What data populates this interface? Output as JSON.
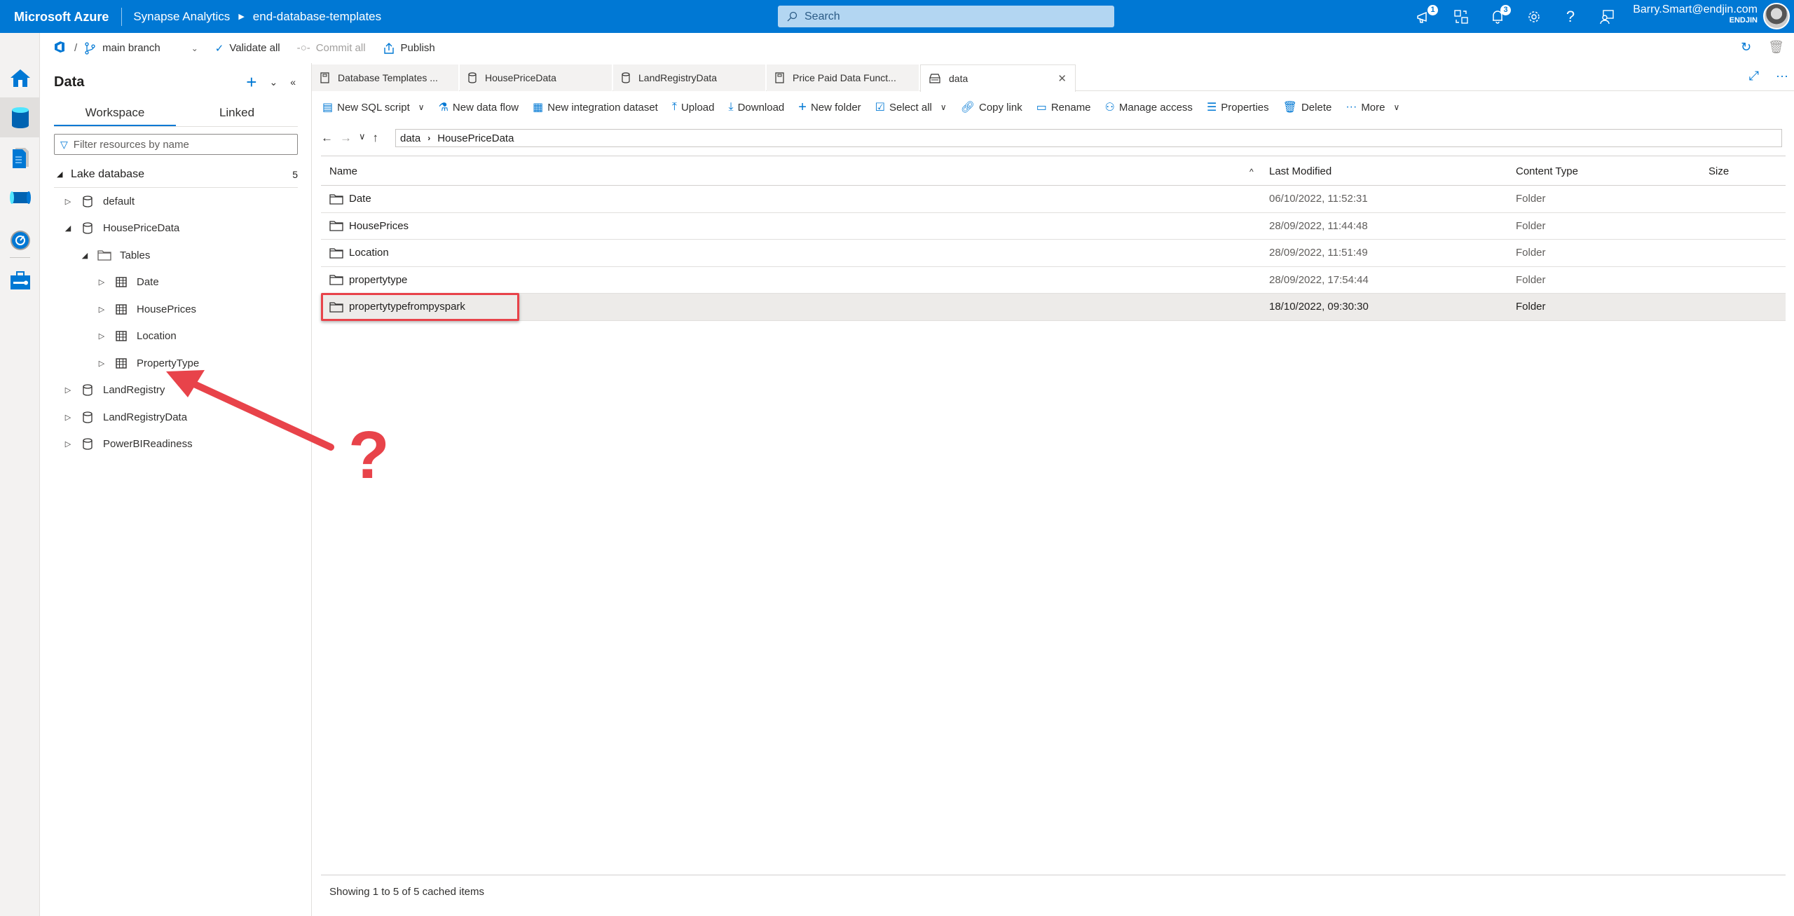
{
  "topbar": {
    "brand": "Microsoft Azure",
    "service": "Synapse Analytics",
    "workspace": "end-database-templates",
    "search_placeholder": "Search",
    "announcements_badge": "1",
    "notifications_badge": "3",
    "user_email": "Barry.Smart@endjin.com",
    "user_org": "ENDJIN"
  },
  "subbar": {
    "separator": "/",
    "branch": "main branch",
    "validate_all": "Validate all",
    "commit_all": "Commit all",
    "publish": "Publish"
  },
  "rail": {
    "items": [
      {
        "name": "home",
        "icon": "home-icon"
      },
      {
        "name": "data",
        "icon": "database-icon",
        "active": true
      },
      {
        "name": "develop",
        "icon": "document-icon"
      },
      {
        "name": "integrate",
        "icon": "pipeline-icon"
      },
      {
        "name": "monitor",
        "icon": "gauge-icon"
      },
      {
        "name": "manage",
        "icon": "toolbox-icon"
      }
    ]
  },
  "datapanel": {
    "title": "Data",
    "tabs": [
      {
        "label": "Workspace",
        "active": true
      },
      {
        "label": "Linked",
        "active": false
      }
    ],
    "filter_placeholder": "Filter resources by name",
    "section": {
      "label": "Lake database",
      "count": "5"
    },
    "tree": [
      {
        "label": "default",
        "level": 1,
        "expanded": false,
        "icon": "database-icon"
      },
      {
        "label": "HousePriceData",
        "level": 1,
        "expanded": true,
        "icon": "database-icon"
      },
      {
        "label": "Tables",
        "level": 2,
        "expanded": true,
        "icon": "folder-icon"
      },
      {
        "label": "Date",
        "level": 3,
        "expanded": false,
        "icon": "table-icon"
      },
      {
        "label": "HousePrices",
        "level": 3,
        "expanded": false,
        "icon": "table-icon"
      },
      {
        "label": "Location",
        "level": 3,
        "expanded": false,
        "icon": "table-icon"
      },
      {
        "label": "PropertyType",
        "level": 3,
        "expanded": false,
        "icon": "table-icon"
      },
      {
        "label": "LandRegistry",
        "level": 1,
        "expanded": false,
        "icon": "database-icon"
      },
      {
        "label": "LandRegistryData",
        "level": 1,
        "expanded": false,
        "icon": "database-icon"
      },
      {
        "label": "PowerBIReadiness",
        "level": 1,
        "expanded": false,
        "icon": "database-icon"
      }
    ]
  },
  "doc_tabs": [
    {
      "label": "Database Templates ...",
      "icon": "notebook-icon"
    },
    {
      "label": "HousePriceData",
      "icon": "database-icon"
    },
    {
      "label": "LandRegistryData",
      "icon": "database-icon"
    },
    {
      "label": "Price Paid Data Funct...",
      "icon": "notebook-icon"
    },
    {
      "label": "data",
      "icon": "storage-icon",
      "active": true,
      "closable": true
    }
  ],
  "toolbar": {
    "new_sql_script": "New SQL script",
    "new_data_flow": "New data flow",
    "new_integration_dataset": "New integration dataset",
    "upload": "Upload",
    "download": "Download",
    "new_folder": "New folder",
    "select_all": "Select all",
    "copy_link": "Copy link",
    "rename": "Rename",
    "manage_access": "Manage access",
    "properties": "Properties",
    "delete": "Delete",
    "more": "More"
  },
  "path": {
    "segments": [
      "data",
      "HousePriceData"
    ]
  },
  "table": {
    "columns": [
      "Name",
      "Last Modified",
      "Content Type",
      "Size"
    ],
    "sort_indicator": "^",
    "rows": [
      {
        "name": "Date",
        "modified": "06/10/2022, 11:52:31",
        "type": "Folder",
        "size": ""
      },
      {
        "name": "HousePrices",
        "modified": "28/09/2022, 11:44:48",
        "type": "Folder",
        "size": ""
      },
      {
        "name": "Location",
        "modified": "28/09/2022, 11:51:49",
        "type": "Folder",
        "size": ""
      },
      {
        "name": "propertytype",
        "modified": "28/09/2022, 17:54:44",
        "type": "Folder",
        "size": ""
      },
      {
        "name": "propertytypefrompyspark",
        "modified": "18/10/2022, 09:30:30",
        "type": "Folder",
        "size": "",
        "selected": true
      }
    ]
  },
  "footer": {
    "status": "Showing 1 to 5 of 5 cached items"
  },
  "annotation": {
    "symbol": "?",
    "color": "#e8434a"
  },
  "colors": {
    "accent": "#0078d4",
    "selected_row": "#edebe9",
    "highlight": "#e8434a"
  }
}
